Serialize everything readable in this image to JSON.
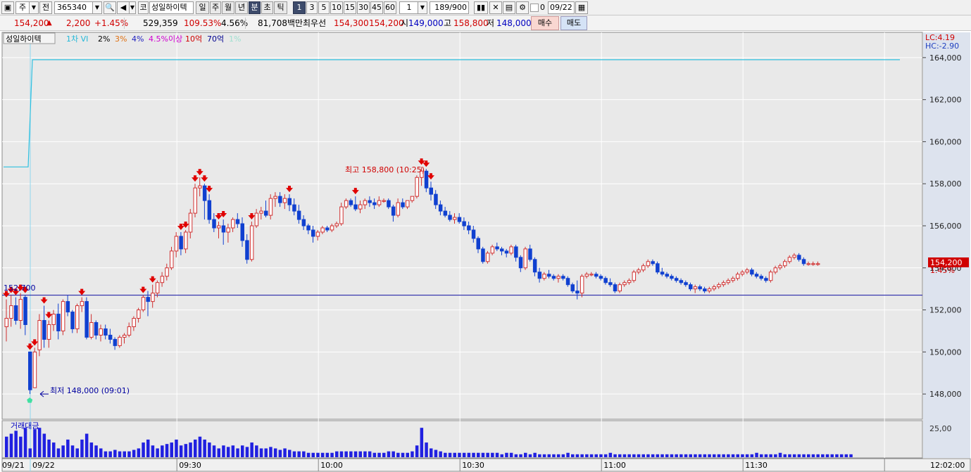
{
  "toolbar": {
    "market_type": "주",
    "prev_label": "전",
    "stock_code": "365340",
    "market_tag": "코",
    "stock_name": "성일하이텍",
    "periods": [
      "일",
      "주",
      "월",
      "년",
      "분",
      "초",
      "틱"
    ],
    "selected_period": "분",
    "intervals": [
      "1",
      "3",
      "5",
      "10",
      "15",
      "30",
      "45",
      "60"
    ],
    "selected_interval": "1",
    "interval_select": "1",
    "bar_count": "189",
    "bar_total": "/900",
    "zero_check": "0",
    "date": "09/22"
  },
  "quote": {
    "price": "154,200",
    "change_arrow": "▲",
    "change": "2,200",
    "change_pct": "+1.45%",
    "volume": "529,359",
    "volume_ratio": "109.53%",
    "turnover": "4.56%",
    "amount": "81,708백만",
    "best_label": "최우선",
    "best_ask": "154,300",
    "best_bid": "154,200",
    "open_label": "시",
    "open": "149,000",
    "high_label": "고",
    "high": "158,800",
    "low_label": "저",
    "low": "148,000",
    "buy_label": "매수",
    "sell_label": "매도"
  },
  "legend": {
    "name": "성일하이텍",
    "items": [
      {
        "label": "1차 VI",
        "color": "#22b8d8"
      },
      {
        "label": "2%",
        "color": "#000000"
      },
      {
        "label": "3%",
        "color": "#e07010"
      },
      {
        "label": "4%",
        "color": "#2020c0"
      },
      {
        "label": "4.5%이상",
        "color": "#d000d0"
      },
      {
        "label": "10억",
        "color": "#d00000"
      },
      {
        "label": "70억",
        "color": "#000090"
      },
      {
        "label": "1%",
        "color": "#a0e0d0"
      }
    ]
  },
  "right_axis": {
    "lc": "LC:4.19",
    "hc": "HC:-2.90",
    "current_price": "154,200",
    "current_pct": "1.45%",
    "vol_tick": "25,00"
  },
  "annotations": {
    "high": "최고 158,800 (10:25)",
    "low": "최저 148,000 (09:01)",
    "ref_line": "152,700"
  },
  "volume_panel": {
    "title": "거래대금"
  },
  "time_axis": {
    "prev_date": "09/21",
    "date": "09/22",
    "end_time": "12:02:00"
  },
  "chart_data": {
    "type": "candlestick",
    "title": "성일하이텍",
    "y_ticks": [
      148000,
      150000,
      152000,
      154000,
      156000,
      158000,
      160000,
      162000,
      164000
    ],
    "y_tick_labels": [
      "148,000",
      "150,000",
      "152,000",
      "154,000",
      "156,000",
      "158,000",
      "160,000",
      "162,000",
      "164,000"
    ],
    "ylim": [
      146800,
      165200
    ],
    "x_ticks": [
      "09:30",
      "10:00",
      "10:30",
      "11:00",
      "11:30"
    ],
    "vi_upper": 163900,
    "vi_prev": 158800,
    "ref_level": 152700,
    "last_price": 154200,
    "grid": true,
    "candles_ohlc": [
      [
        151200,
        152500,
        150500,
        151600
      ],
      [
        151600,
        152700,
        151200,
        152200
      ],
      [
        152200,
        152600,
        151300,
        151500
      ],
      [
        151500,
        152800,
        151100,
        152500
      ],
      [
        152600,
        152700,
        150800,
        151300
      ],
      [
        150000,
        150000,
        148000,
        148200
      ],
      [
        148300,
        150200,
        148300,
        150000
      ],
      [
        150100,
        151800,
        149800,
        151500
      ],
      [
        151500,
        152200,
        150200,
        150600
      ],
      [
        150600,
        151500,
        150200,
        151300
      ],
      [
        151300,
        152000,
        151000,
        151800
      ],
      [
        151800,
        152300,
        150600,
        151000
      ],
      [
        151000,
        152500,
        150800,
        152400
      ],
      [
        152400,
        152700,
        151700,
        151900
      ],
      [
        151900,
        152000,
        150900,
        151100
      ],
      [
        151100,
        152300,
        150900,
        152200
      ],
      [
        152200,
        152600,
        151900,
        152400
      ],
      [
        152400,
        152600,
        150600,
        150700
      ],
      [
        150700,
        151800,
        150600,
        151400
      ],
      [
        151400,
        151500,
        150600,
        150800
      ],
      [
        150800,
        151300,
        150500,
        151100
      ],
      [
        151100,
        151300,
        150600,
        150800
      ],
      [
        150800,
        151100,
        150400,
        150600
      ],
      [
        150600,
        150700,
        150100,
        150300
      ],
      [
        150300,
        150800,
        150200,
        150700
      ],
      [
        150700,
        150900,
        150400,
        150800
      ],
      [
        150800,
        151400,
        150700,
        151200
      ],
      [
        151200,
        151700,
        151000,
        151600
      ],
      [
        151600,
        152100,
        151400,
        152000
      ],
      [
        152000,
        152700,
        151900,
        152600
      ],
      [
        152600,
        152900,
        151700,
        152400
      ],
      [
        152400,
        153200,
        152100,
        152800
      ],
      [
        152800,
        153400,
        152600,
        153300
      ],
      [
        153300,
        153800,
        153100,
        153600
      ],
      [
        153600,
        154200,
        153400,
        154000
      ],
      [
        154000,
        155000,
        153900,
        154800
      ],
      [
        154800,
        155700,
        154500,
        155500
      ],
      [
        155500,
        155700,
        154600,
        154900
      ],
      [
        154900,
        155800,
        154700,
        155700
      ],
      [
        155700,
        156800,
        155400,
        156600
      ],
      [
        156600,
        158000,
        156400,
        157800
      ],
      [
        157800,
        158300,
        157400,
        157900
      ],
      [
        157900,
        158000,
        156300,
        157200
      ],
      [
        157200,
        157500,
        156100,
        156300
      ],
      [
        156300,
        156600,
        155700,
        155900
      ],
      [
        155900,
        156200,
        155400,
        156000
      ],
      [
        156000,
        156300,
        155100,
        155700
      ],
      [
        155700,
        156100,
        155200,
        155900
      ],
      [
        155900,
        156400,
        155700,
        156300
      ],
      [
        156300,
        156600,
        155900,
        156100
      ],
      [
        156100,
        156400,
        155000,
        155300
      ],
      [
        155300,
        155600,
        154200,
        154400
      ],
      [
        154400,
        156200,
        154300,
        156000
      ],
      [
        156000,
        156800,
        155900,
        156600
      ],
      [
        156600,
        156900,
        156300,
        156700
      ],
      [
        156700,
        157200,
        156400,
        156500
      ],
      [
        156500,
        157500,
        156300,
        157300
      ],
      [
        157300,
        157600,
        156900,
        157400
      ],
      [
        157400,
        157600,
        156900,
        157100
      ],
      [
        157100,
        157500,
        156800,
        157300
      ],
      [
        157300,
        157500,
        156700,
        157000
      ],
      [
        157000,
        157300,
        156500,
        156700
      ],
      [
        156700,
        157000,
        156100,
        156300
      ],
      [
        156300,
        156500,
        155800,
        156000
      ],
      [
        156000,
        156100,
        155600,
        155800
      ],
      [
        155800,
        156000,
        155200,
        155500
      ],
      [
        155500,
        155800,
        155300,
        155700
      ],
      [
        155700,
        156000,
        155600,
        155900
      ],
      [
        155900,
        156000,
        155700,
        155800
      ],
      [
        155800,
        156100,
        155700,
        156000
      ],
      [
        156000,
        156200,
        155900,
        156100
      ],
      [
        156100,
        157100,
        156000,
        156900
      ],
      [
        156900,
        157300,
        156800,
        157200
      ],
      [
        157200,
        157300,
        156900,
        157000
      ],
      [
        157000,
        157400,
        156700,
        156800
      ],
      [
        156800,
        157200,
        156600,
        157000
      ],
      [
        157000,
        157300,
        156800,
        157200
      ],
      [
        157200,
        157400,
        156900,
        157100
      ],
      [
        157100,
        157300,
        156800,
        157000
      ],
      [
        157000,
        157400,
        156900,
        157200
      ],
      [
        157200,
        157300,
        157100,
        157200
      ],
      [
        157200,
        157300,
        156800,
        156900
      ],
      [
        156900,
        157000,
        156200,
        156500
      ],
      [
        156500,
        157300,
        156400,
        157100
      ],
      [
        157100,
        157300,
        156800,
        156900
      ],
      [
        156900,
        157200,
        156800,
        157200
      ],
      [
        157200,
        157400,
        157100,
        157400
      ],
      [
        157400,
        158400,
        157300,
        158300
      ],
      [
        158300,
        158800,
        157900,
        158600
      ],
      [
        158600,
        158700,
        157600,
        157800
      ],
      [
        157800,
        158100,
        157200,
        157500
      ],
      [
        157500,
        157700,
        156800,
        157000
      ],
      [
        157000,
        157200,
        156500,
        156700
      ],
      [
        156700,
        156900,
        156400,
        156500
      ],
      [
        156500,
        156700,
        156200,
        156300
      ],
      [
        156300,
        156600,
        156100,
        156400
      ],
      [
        156400,
        156600,
        156100,
        156200
      ],
      [
        156200,
        156400,
        155800,
        156000
      ],
      [
        156000,
        156200,
        155600,
        155800
      ],
      [
        155800,
        156000,
        155200,
        155400
      ],
      [
        155400,
        155500,
        154700,
        154900
      ],
      [
        154900,
        155000,
        154200,
        154300
      ],
      [
        154300,
        154800,
        154200,
        154700
      ],
      [
        154700,
        155100,
        154600,
        155000
      ],
      [
        155000,
        155200,
        154800,
        154900
      ],
      [
        154900,
        155000,
        154600,
        154800
      ],
      [
        154800,
        154900,
        154500,
        154700
      ],
      [
        154700,
        155100,
        154600,
        155000
      ],
      [
        155000,
        155100,
        154300,
        154500
      ],
      [
        154500,
        154600,
        153800,
        154000
      ],
      [
        154000,
        155000,
        153900,
        154900
      ],
      [
        154900,
        155100,
        154300,
        154400
      ],
      [
        154400,
        154500,
        153600,
        153800
      ],
      [
        153800,
        154000,
        153300,
        153500
      ],
      [
        153500,
        153800,
        153400,
        153700
      ],
      [
        153700,
        153900,
        153500,
        153600
      ],
      [
        153600,
        153700,
        153400,
        153500
      ],
      [
        153500,
        153700,
        153300,
        153600
      ],
      [
        153600,
        153700,
        153400,
        153500
      ],
      [
        153500,
        153600,
        153100,
        153200
      ],
      [
        153200,
        153300,
        152800,
        152900
      ],
      [
        152900,
        153400,
        152500,
        152800
      ],
      [
        152800,
        153700,
        152600,
        153600
      ],
      [
        153600,
        153800,
        153500,
        153700
      ],
      [
        153700,
        153800,
        153600,
        153700
      ],
      [
        153700,
        153800,
        153500,
        153600
      ],
      [
        153600,
        153700,
        153400,
        153500
      ],
      [
        153500,
        153600,
        153200,
        153300
      ],
      [
        153300,
        153500,
        153100,
        153200
      ],
      [
        153200,
        153300,
        152800,
        152900
      ],
      [
        152900,
        153300,
        152800,
        153200
      ],
      [
        153200,
        153400,
        153100,
        153300
      ],
      [
        153300,
        153500,
        153200,
        153400
      ],
      [
        153400,
        153900,
        153300,
        153800
      ],
      [
        153800,
        154000,
        153700,
        153900
      ],
      [
        153900,
        154200,
        153800,
        154100
      ],
      [
        154100,
        154400,
        154000,
        154300
      ],
      [
        154300,
        154400,
        154100,
        154200
      ],
      [
        154200,
        154300,
        153700,
        153800
      ],
      [
        153800,
        154000,
        153600,
        153700
      ],
      [
        153700,
        153800,
        153500,
        153600
      ],
      [
        153600,
        153700,
        153400,
        153500
      ],
      [
        153500,
        153600,
        153300,
        153400
      ],
      [
        153400,
        153500,
        153200,
        153300
      ],
      [
        153300,
        153400,
        153100,
        153200
      ],
      [
        153200,
        153300,
        152900,
        153000
      ],
      [
        153000,
        153200,
        152800,
        153100
      ],
      [
        153100,
        153200,
        152900,
        153000
      ],
      [
        153000,
        153100,
        152800,
        152900
      ],
      [
        152900,
        153100,
        152800,
        153000
      ],
      [
        153000,
        153200,
        152900,
        153100
      ],
      [
        153100,
        153300,
        153000,
        153200
      ],
      [
        153200,
        153400,
        153100,
        153300
      ],
      [
        153300,
        153500,
        153200,
        153400
      ],
      [
        153400,
        153600,
        153300,
        153500
      ],
      [
        153500,
        153800,
        153400,
        153700
      ],
      [
        153700,
        153900,
        153600,
        153800
      ],
      [
        153800,
        154000,
        153700,
        153900
      ],
      [
        153900,
        154000,
        153600,
        153700
      ],
      [
        153700,
        153800,
        153500,
        153600
      ],
      [
        153600,
        153700,
        153400,
        153500
      ],
      [
        153500,
        153600,
        153300,
        153400
      ],
      [
        153400,
        153900,
        153300,
        153800
      ],
      [
        153800,
        154100,
        153700,
        154000
      ],
      [
        154000,
        154200,
        153900,
        154100
      ],
      [
        154100,
        154400,
        154000,
        154300
      ],
      [
        154300,
        154600,
        154200,
        154500
      ],
      [
        154500,
        154700,
        154400,
        154600
      ],
      [
        154600,
        154700,
        154300,
        154400
      ],
      [
        154400,
        154500,
        154100,
        154200
      ],
      [
        154200,
        154300,
        154100,
        154200
      ],
      [
        154200,
        154300,
        154100,
        154200
      ],
      [
        154200,
        154300,
        154100,
        154200
      ]
    ],
    "volume_series": [
      14,
      16,
      18,
      14,
      20,
      6,
      19,
      20,
      16,
      12,
      10,
      6,
      8,
      12,
      8,
      6,
      12,
      16,
      10,
      8,
      6,
      4,
      4,
      5,
      4,
      4,
      4,
      5,
      6,
      10,
      12,
      8,
      6,
      8,
      9,
      10,
      12,
      8,
      9,
      10,
      12,
      14,
      12,
      10,
      8,
      6,
      8,
      7,
      8,
      6,
      8,
      7,
      10,
      8,
      6,
      6,
      7,
      6,
      5,
      6,
      5,
      4,
      4,
      4,
      3,
      3,
      3,
      3,
      3,
      3,
      4,
      4,
      4,
      4,
      4,
      4,
      4,
      4,
      3,
      3,
      3,
      4,
      4,
      3,
      3,
      3,
      4,
      8,
      20,
      10,
      6,
      5,
      4,
      3,
      3,
      3,
      3,
      3,
      3,
      3,
      3,
      3,
      3,
      3,
      3,
      2,
      3,
      3,
      2,
      2,
      3,
      2,
      3,
      2,
      2,
      2,
      2,
      2,
      2,
      3,
      2,
      2,
      2,
      2,
      2,
      2,
      2,
      2,
      3,
      2,
      2,
      2,
      2,
      2,
      2,
      2,
      2,
      2,
      2,
      2,
      2,
      2,
      2,
      2,
      2,
      2,
      2,
      2,
      2,
      2,
      2,
      2,
      2,
      2,
      2,
      2,
      2,
      2,
      2,
      3,
      2,
      2,
      2,
      2,
      3,
      2,
      2,
      2,
      2,
      2,
      2,
      2,
      2,
      2,
      2,
      2,
      2,
      2,
      2,
      2
    ],
    "signal_down_idx": [
      0,
      1,
      2,
      3,
      4,
      5,
      6,
      8,
      9,
      16,
      29,
      31,
      37,
      38,
      40,
      41,
      42,
      43,
      45,
      46,
      52,
      60,
      74,
      88,
      89,
      90
    ],
    "signal_up_idx": [
      6
    ]
  }
}
